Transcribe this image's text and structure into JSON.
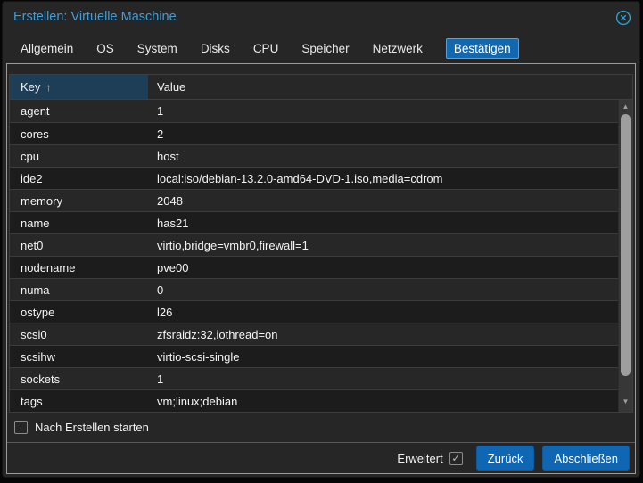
{
  "window": {
    "title": "Erstellen: Virtuelle Maschine"
  },
  "tabs": [
    {
      "label": "Allgemein",
      "active": false
    },
    {
      "label": "OS",
      "active": false
    },
    {
      "label": "System",
      "active": false
    },
    {
      "label": "Disks",
      "active": false
    },
    {
      "label": "CPU",
      "active": false
    },
    {
      "label": "Speicher",
      "active": false
    },
    {
      "label": "Netzwerk",
      "active": false
    },
    {
      "label": "Bestätigen",
      "active": true
    }
  ],
  "table": {
    "columns": [
      {
        "label": "Key",
        "sorted": "asc"
      },
      {
        "label": "Value",
        "sorted": null
      }
    ],
    "rows": [
      {
        "key": "agent",
        "value": "1"
      },
      {
        "key": "cores",
        "value": "2"
      },
      {
        "key": "cpu",
        "value": "host"
      },
      {
        "key": "ide2",
        "value": "local:iso/debian-13.2.0-amd64-DVD-1.iso,media=cdrom"
      },
      {
        "key": "memory",
        "value": "2048"
      },
      {
        "key": "name",
        "value": "has21"
      },
      {
        "key": "net0",
        "value": "virtio,bridge=vmbr0,firewall=1"
      },
      {
        "key": "nodename",
        "value": "pve00"
      },
      {
        "key": "numa",
        "value": "0"
      },
      {
        "key": "ostype",
        "value": "l26"
      },
      {
        "key": "scsi0",
        "value": "zfsraidz:32,iothread=on"
      },
      {
        "key": "scsihw",
        "value": "virtio-scsi-single"
      },
      {
        "key": "sockets",
        "value": "1"
      },
      {
        "key": "tags",
        "value": "vm;linux;debian"
      }
    ]
  },
  "start_checkbox": {
    "label": "Nach Erstellen starten",
    "checked": false
  },
  "footer": {
    "advanced_label": "Erweitert",
    "advanced_checked": true,
    "back_label": "Zurück",
    "finish_label": "Abschließen"
  },
  "icons": {
    "sort_asc": "↑",
    "scroll_up": "▲",
    "scroll_down": "▼",
    "check": "✓"
  },
  "colors": {
    "title_text": "#3f9dd9",
    "close_icon": "#2d9fcd",
    "active_tab_bg": "#1268ae",
    "active_tab_border": "#55a2d8",
    "key_header_bg": "#1d3e56",
    "button_bg": "#0f67b4",
    "row_odd": "#272727",
    "row_even": "#1c1c1c",
    "dialog_bg": "#262626"
  }
}
